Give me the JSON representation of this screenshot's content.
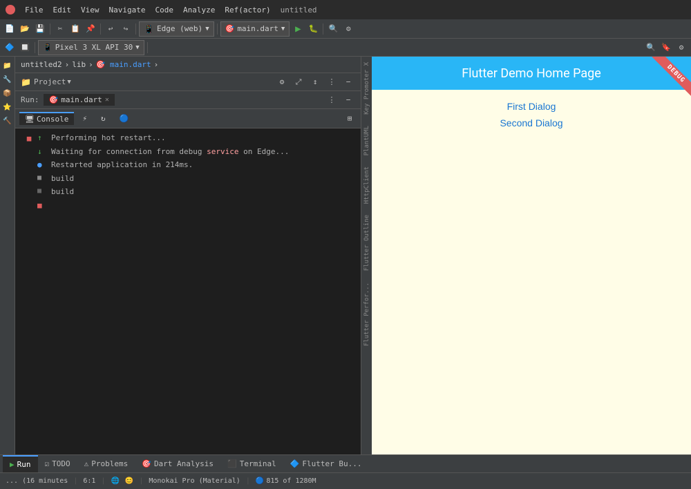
{
  "titlebar": {
    "title": "untitled",
    "menus": [
      "File",
      "Edit",
      "View",
      "Navigate",
      "Code",
      "Analyze",
      "Ref(actor)"
    ]
  },
  "toolbar": {
    "device_selector": "Edge (web)",
    "run_config": "main.dart",
    "pixel_device": "Pixel 3 XL API 30"
  },
  "breadcrumb": {
    "items": [
      "untitled2",
      "lib",
      "main.dart"
    ]
  },
  "run_panel": {
    "label": "Run:",
    "tab_label": "main.dart"
  },
  "console": {
    "tabs": [
      "Console",
      "⚡",
      "↻",
      "🔵"
    ],
    "lines": [
      {
        "icon": "arrow-up",
        "text": "Performing hot restart..."
      },
      {
        "icon": "arrow-down",
        "text": "Waiting for connection from debug service on Edge..."
      },
      {
        "icon": "circle",
        "text": "Restarted application in 214ms."
      },
      {
        "icon": "build-icon",
        "text": "build"
      },
      {
        "icon": "build-icon2",
        "text": "build"
      },
      {
        "icon": "red-sq",
        "text": ""
      }
    ]
  },
  "preview": {
    "title": "Flutter Demo Home Page",
    "links": [
      "First Dialog",
      "Second Dialog"
    ],
    "debug_label": "DEBUG"
  },
  "right_tabs": [
    "Key Promoter X",
    "PlantUML",
    "HttpClient",
    "Flutter Outline",
    "Flutter Perfor..."
  ],
  "bottom_tabs": [
    {
      "label": "Run",
      "active": true
    },
    {
      "label": "TODO"
    },
    {
      "label": "Problems"
    },
    {
      "label": "Dart Analysis"
    },
    {
      "label": "Terminal"
    },
    {
      "label": "Flutter Bu..."
    }
  ],
  "statusbar": {
    "time": "... (16 minutes",
    "position": "6:1",
    "font": "Monokai Pro (Material)",
    "memory": "815 of 1280M"
  }
}
